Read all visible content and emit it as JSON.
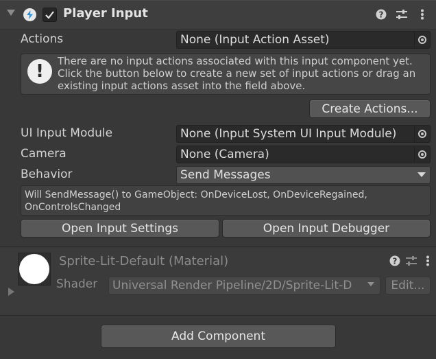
{
  "component": {
    "title": "Player Input",
    "enabled": true
  },
  "actions": {
    "label": "Actions",
    "value": "None (Input Action Asset)"
  },
  "help": {
    "text": "There are no input actions associated with this input component yet. Click the button below to create a new set of input actions or drag an existing input actions asset into the field above."
  },
  "create_actions_label": "Create Actions...",
  "ui_input_module": {
    "label": "UI Input Module",
    "value": "None (Input System UI Input Module)"
  },
  "camera": {
    "label": "Camera",
    "value": "None (Camera)"
  },
  "behavior": {
    "label": "Behavior",
    "value": "Send Messages"
  },
  "behavior_info": "Will SendMessage() to GameObject: OnDeviceLost, OnDeviceRegained, OnControlsChanged",
  "open_settings_label": "Open Input Settings",
  "open_debugger_label": "Open Input Debugger",
  "material": {
    "title": "Sprite-Lit-Default (Material)",
    "shader_label": "Shader",
    "shader_value": "Universal Render Pipeline/2D/Sprite-Lit-D",
    "edit_label": "Edit..."
  },
  "add_component_label": "Add Component",
  "colors": {
    "background": "#383838",
    "field": "#2a2a2a",
    "button": "#585858"
  }
}
